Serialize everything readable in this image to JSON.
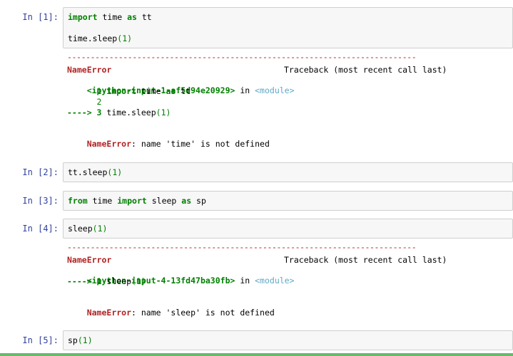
{
  "cells": [
    {
      "prompt": "In  [1]:",
      "code": [
        [
          [
            "kw",
            "import"
          ],
          [
            "t",
            " time "
          ],
          [
            "kw",
            "as"
          ],
          [
            "t",
            " tt"
          ]
        ],
        [
          [
            "t",
            "time.sleep"
          ],
          [
            "paren",
            "("
          ],
          [
            "num",
            "1"
          ],
          [
            "paren",
            ")"
          ]
        ]
      ],
      "traceback": {
        "dashes": "---------------------------------------------------------------------------",
        "error_name": "NameError",
        "traceback_label": "Traceback (most recent call last)",
        "file": "<ipython-input-1-af5d94e20929>",
        "in_word": " in ",
        "module": "<module>",
        "lines": [
          [
            [
              "num",
              "      1 "
            ],
            [
              "kw",
              "import"
            ],
            [
              "t",
              " time "
            ],
            [
              "kw",
              "as"
            ],
            [
              "t",
              " tt"
            ]
          ],
          [
            [
              "num",
              "      2"
            ]
          ],
          [
            [
              "arrow",
              "----> 3 "
            ],
            [
              "t",
              "time.sleep"
            ],
            [
              "paren",
              "("
            ],
            [
              "num",
              "1"
            ],
            [
              "paren",
              ")"
            ]
          ]
        ],
        "message_name": "NameError",
        "message": ": name 'time' is not defined"
      }
    },
    {
      "prompt": "In  [2]:",
      "code": [
        [
          [
            "t",
            "tt.sleep"
          ],
          [
            "paren",
            "("
          ],
          [
            "num",
            "1"
          ],
          [
            "paren",
            ")"
          ]
        ]
      ]
    },
    {
      "prompt": "In  [3]:",
      "code": [
        [
          [
            "kw",
            "from"
          ],
          [
            "t",
            " time "
          ],
          [
            "kw",
            "import"
          ],
          [
            "t",
            " sleep "
          ],
          [
            "kw",
            "as"
          ],
          [
            "t",
            " sp"
          ]
        ]
      ]
    },
    {
      "prompt": "In  [4]:",
      "code": [
        [
          [
            "t",
            "sleep"
          ],
          [
            "paren",
            "("
          ],
          [
            "num",
            "1"
          ],
          [
            "paren",
            ")"
          ]
        ]
      ],
      "traceback": {
        "dashes": "---------------------------------------------------------------------------",
        "error_name": "NameError",
        "traceback_label": "Traceback (most recent call last)",
        "file": "<ipython-input-4-13fd47ba30fb>",
        "in_word": " in ",
        "module": "<module>",
        "lines": [
          [
            [
              "arrow",
              "----> 1 "
            ],
            [
              "t",
              "sleep"
            ],
            [
              "paren",
              "("
            ],
            [
              "num",
              "1"
            ],
            [
              "paren",
              ")"
            ]
          ]
        ],
        "message_name": "NameError",
        "message": ": name 'sleep' is not defined"
      }
    },
    {
      "prompt": "In  [5]:",
      "code": [
        [
          [
            "t",
            "sp"
          ],
          [
            "paren",
            "("
          ],
          [
            "num",
            "1"
          ],
          [
            "paren",
            ")"
          ]
        ]
      ]
    }
  ],
  "colors": {
    "prompt": "#303f9f",
    "keyword": "#008000",
    "error": "#b22222",
    "module": "#5fa8c6",
    "cell_bg": "#f7f7f7",
    "cell_border": "#cfcfcf"
  }
}
